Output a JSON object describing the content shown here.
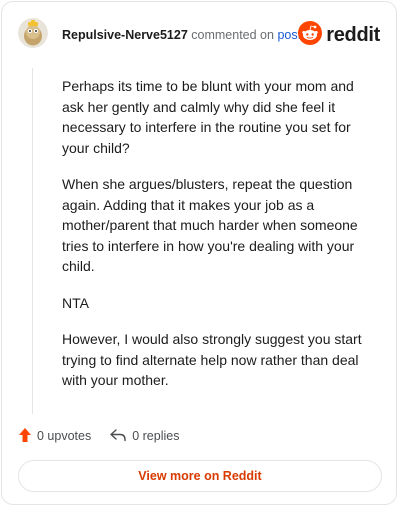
{
  "comment": {
    "username": "Repulsive-Nerve5127",
    "action": "commented on",
    "post_link": "post",
    "paragraphs": [
      "Perhaps its time to be blunt with your mom and ask her gently and calmly why did she feel it necessary to interfere in the routine you set for your child?",
      "When she argues/blusters, repeat the question again. Adding that it makes your job as a mother/parent that much harder when someone tries to interfere in how you're dealing with your child.",
      "NTA",
      "However, I would also strongly suggest you start trying to find alternate help now rather than deal with your mother."
    ]
  },
  "brand": {
    "wordmark": "reddit",
    "accent": "#ff4500",
    "icon": "reddit-snoo-icon"
  },
  "stats": {
    "upvotes_label": "0 upvotes",
    "replies_label": "0 replies",
    "upvote_icon": "upvote-arrow-icon",
    "reply_icon": "reply-arrow-icon"
  },
  "footer": {
    "view_more_label": "View more on Reddit",
    "view_more_color": "#d93a00"
  }
}
